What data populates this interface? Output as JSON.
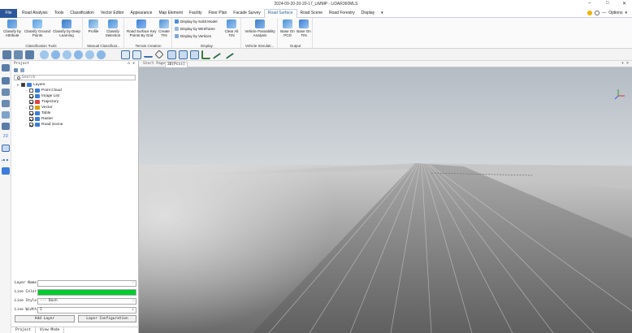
{
  "window": {
    "title": "2024-09-20-20-20-17_LiMMP - LiDAR360MLS",
    "controls": [
      "–",
      "□",
      "✕"
    ]
  },
  "menu": {
    "file": "File",
    "tabs": [
      "Road Analysis",
      "Tools",
      "Classification",
      "Vector Editor",
      "Appearance",
      "Map Element",
      "Facility",
      "Floor Plan",
      "Facade Survey",
      "Road Surface",
      "Road Scene",
      "Road Forestry",
      "Display",
      "▾"
    ],
    "active_tab": "Road Surface",
    "options": "Options",
    "options_arrow": "▾",
    "minus": "—"
  },
  "ribbon": {
    "groups": [
      {
        "label": "Classification Tools",
        "buttons": [
          "Classify by\nAttribute",
          "Classify Ground\nPoints",
          "Classify by Deep\nLearning"
        ]
      },
      {
        "label": "Manual Classificat...",
        "buttons": [
          "Profile",
          "Classify\nSelection"
        ]
      },
      {
        "label": "Terrain Creation",
        "buttons": [
          "Road Surface Key\nPoints By Grid",
          "Create\nTIN"
        ]
      },
      {
        "label": "Display",
        "small": [
          "Display by Solid Model",
          "Display by Wireframe",
          "Display by Vertices"
        ],
        "buttons": [
          "Clear All\nTIN"
        ]
      },
      {
        "label": "Vehicle Simulati...",
        "buttons": [
          "Vehicle Passability\nAnalysis"
        ]
      },
      {
        "label": "Output",
        "buttons": [
          "Base On\nPCD",
          "Base On\nTIN"
        ]
      }
    ]
  },
  "project": {
    "header": "Project",
    "pin": "⌂ ✕",
    "search_placeholder": "Search",
    "layers": [
      {
        "label": "Layers",
        "level": 0,
        "expander": "▾",
        "check": "partial",
        "icon_color": "#3b7dd8"
      },
      {
        "label": "Point Cloud",
        "level": 1,
        "expander": "›",
        "check": "off",
        "icon_color": "#3b7dd8"
      },
      {
        "label": "Image List",
        "level": 1,
        "expander": "",
        "check": "on",
        "icon_color": "#3b7dd8"
      },
      {
        "label": "Trajectory",
        "level": 1,
        "expander": "",
        "check": "on",
        "icon_color": "#d44"
      },
      {
        "label": "Vector",
        "level": 1,
        "expander": "›",
        "check": "off",
        "icon_color": "#e0a000"
      },
      {
        "label": "Table",
        "level": 1,
        "expander": "",
        "check": "on",
        "icon_color": "#3b7dd8"
      },
      {
        "label": "Raster",
        "level": 1,
        "expander": "",
        "check": "on",
        "icon_color": "#3b7dd8"
      },
      {
        "label": "Road Scene",
        "level": 1,
        "expander": "›",
        "check": "on",
        "icon_color": "#3b7dd8"
      }
    ],
    "properties": {
      "layer_name_label": "Layer Name",
      "layer_name_value": "",
      "line_color_label": "Line Color",
      "line_color_value": "#00cc2f",
      "line_style_label": "Line Style",
      "line_style_value": "--- Dash",
      "line_width_label": "Line Width",
      "line_width_value": "2",
      "add_layer": "Add Layer",
      "layer_configuration": "Layer Configuration"
    },
    "bottom_tabs": [
      "Project",
      "View Mode"
    ]
  },
  "viewport": {
    "tabs": [
      "Start Page",
      "3D[Pcss]"
    ],
    "active_tab": "3D[Pcss]",
    "controls": "▾ ×",
    "left_bar_label": "2D"
  },
  "colors": {
    "accent": "#2b579a",
    "sky_top": "#b4bcc4",
    "sky_bottom": "#d6dade",
    "road": "#7a7a7a"
  }
}
